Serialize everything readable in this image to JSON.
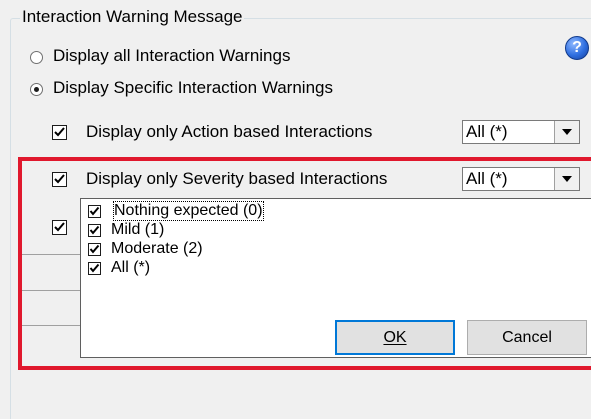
{
  "group": {
    "title": "Interaction Warning Message"
  },
  "radios": [
    {
      "label": "Display all Interaction Warnings",
      "selected": false
    },
    {
      "label": "Display Specific Interaction Warnings",
      "selected": true
    }
  ],
  "options": {
    "action": {
      "label": "Display only Action based Interactions",
      "checked": true,
      "combo_value": "All (*)"
    },
    "severity": {
      "label": "Display only Severity based Interactions",
      "checked": true,
      "combo_value": "All (*)"
    },
    "third": {
      "checked": true
    }
  },
  "dropdown": {
    "items": [
      {
        "label": "Nothing expected (0)",
        "checked": true
      },
      {
        "label": "Mild (1)",
        "checked": true
      },
      {
        "label": "Moderate (2)",
        "checked": true
      },
      {
        "label": "All (*)",
        "checked": true
      }
    ],
    "ok_label": "OK",
    "cancel_label": "Cancel"
  },
  "icons": {
    "help": "help-icon",
    "check": "checkmark-icon",
    "dropdown_arrow": "chevron-down-icon"
  },
  "colors": {
    "highlight_frame": "#e0182d",
    "help_icon": "#2f6fe0"
  }
}
